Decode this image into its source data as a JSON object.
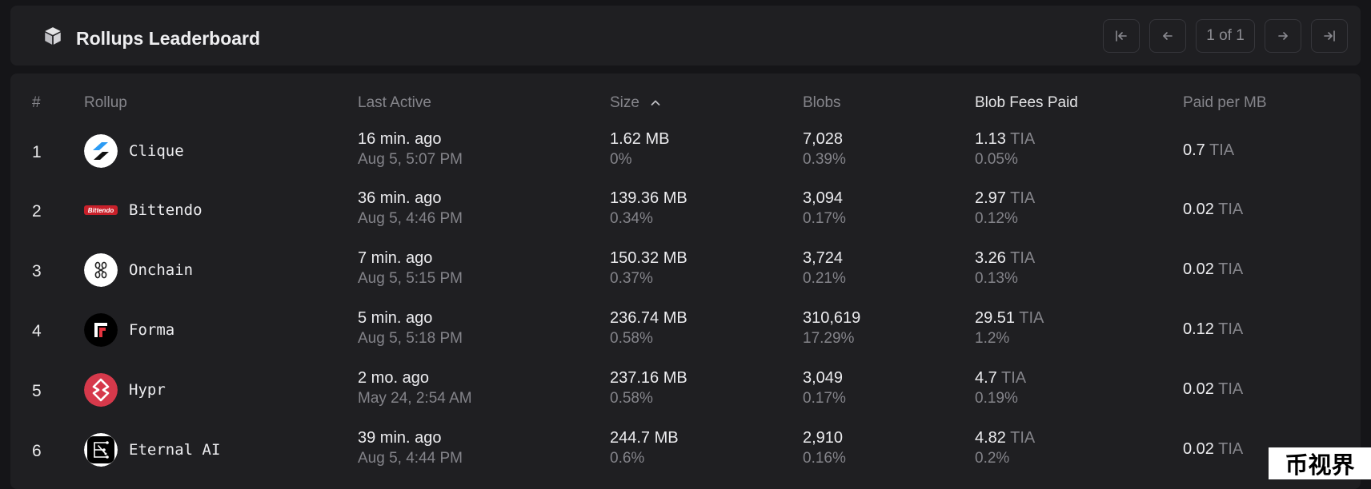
{
  "header": {
    "title": "Rollups Leaderboard",
    "page_indicator": "1 of 1",
    "icons": {
      "box": "package-icon",
      "first": "first-page-icon",
      "prev": "prev-page-icon",
      "next": "next-page-icon",
      "last": "last-page-icon"
    }
  },
  "table": {
    "columns": {
      "rank": "#",
      "rollup": "Rollup",
      "last_active": "Last Active",
      "size": "Size",
      "blobs": "Blobs",
      "fees": "Blob Fees Paid",
      "paid_per_mb": "Paid per MB"
    },
    "sort_icon": "chevron-up-icon",
    "unit": "TIA",
    "rows": [
      {
        "rank": "1",
        "name": "Clique",
        "ago": "16 min. ago",
        "date": "Aug 5, 5:07 PM",
        "size": "1.62 MB",
        "size_pct": "0%",
        "blobs": "7,028",
        "blobs_pct": "0.39%",
        "fees": "1.13",
        "fees_pct": "0.05%",
        "ppm": "0.7"
      },
      {
        "rank": "2",
        "name": "Bittendo",
        "logo_text": "Bittendo",
        "ago": "36 min. ago",
        "date": "Aug 5, 4:46 PM",
        "size": "139.36 MB",
        "size_pct": "0.34%",
        "blobs": "3,094",
        "blobs_pct": "0.17%",
        "fees": "2.97",
        "fees_pct": "0.12%",
        "ppm": "0.02"
      },
      {
        "rank": "3",
        "name": "Onchain",
        "ago": "7 min. ago",
        "date": "Aug 5, 5:15 PM",
        "size": "150.32 MB",
        "size_pct": "0.37%",
        "blobs": "3,724",
        "blobs_pct": "0.21%",
        "fees": "3.26",
        "fees_pct": "0.13%",
        "ppm": "0.02"
      },
      {
        "rank": "4",
        "name": "Forma",
        "ago": "5 min. ago",
        "date": "Aug 5, 5:18 PM",
        "size": "236.74 MB",
        "size_pct": "0.58%",
        "blobs": "310,619",
        "blobs_pct": "17.29%",
        "fees": "29.51",
        "fees_pct": "1.2%",
        "ppm": "0.12"
      },
      {
        "rank": "5",
        "name": "Hypr",
        "ago": "2 mo. ago",
        "date": "May 24, 2:54 AM",
        "size": "237.16 MB",
        "size_pct": "0.58%",
        "blobs": "3,049",
        "blobs_pct": "0.17%",
        "fees": "4.7",
        "fees_pct": "0.19%",
        "ppm": "0.02"
      },
      {
        "rank": "6",
        "name": "Eternal AI",
        "ago": "39 min. ago",
        "date": "Aug 5, 4:44 PM",
        "size": "244.7 MB",
        "size_pct": "0.6%",
        "blobs": "2,910",
        "blobs_pct": "0.16%",
        "fees": "4.82",
        "fees_pct": "0.2%",
        "ppm": "0.02"
      }
    ]
  },
  "watermark": "币视界",
  "colors": {
    "background": "#151518",
    "panel": "#1f1f22",
    "muted_text": "#84848a",
    "hypr_red": "#d6394b",
    "bittendo_red": "#c8202a"
  }
}
